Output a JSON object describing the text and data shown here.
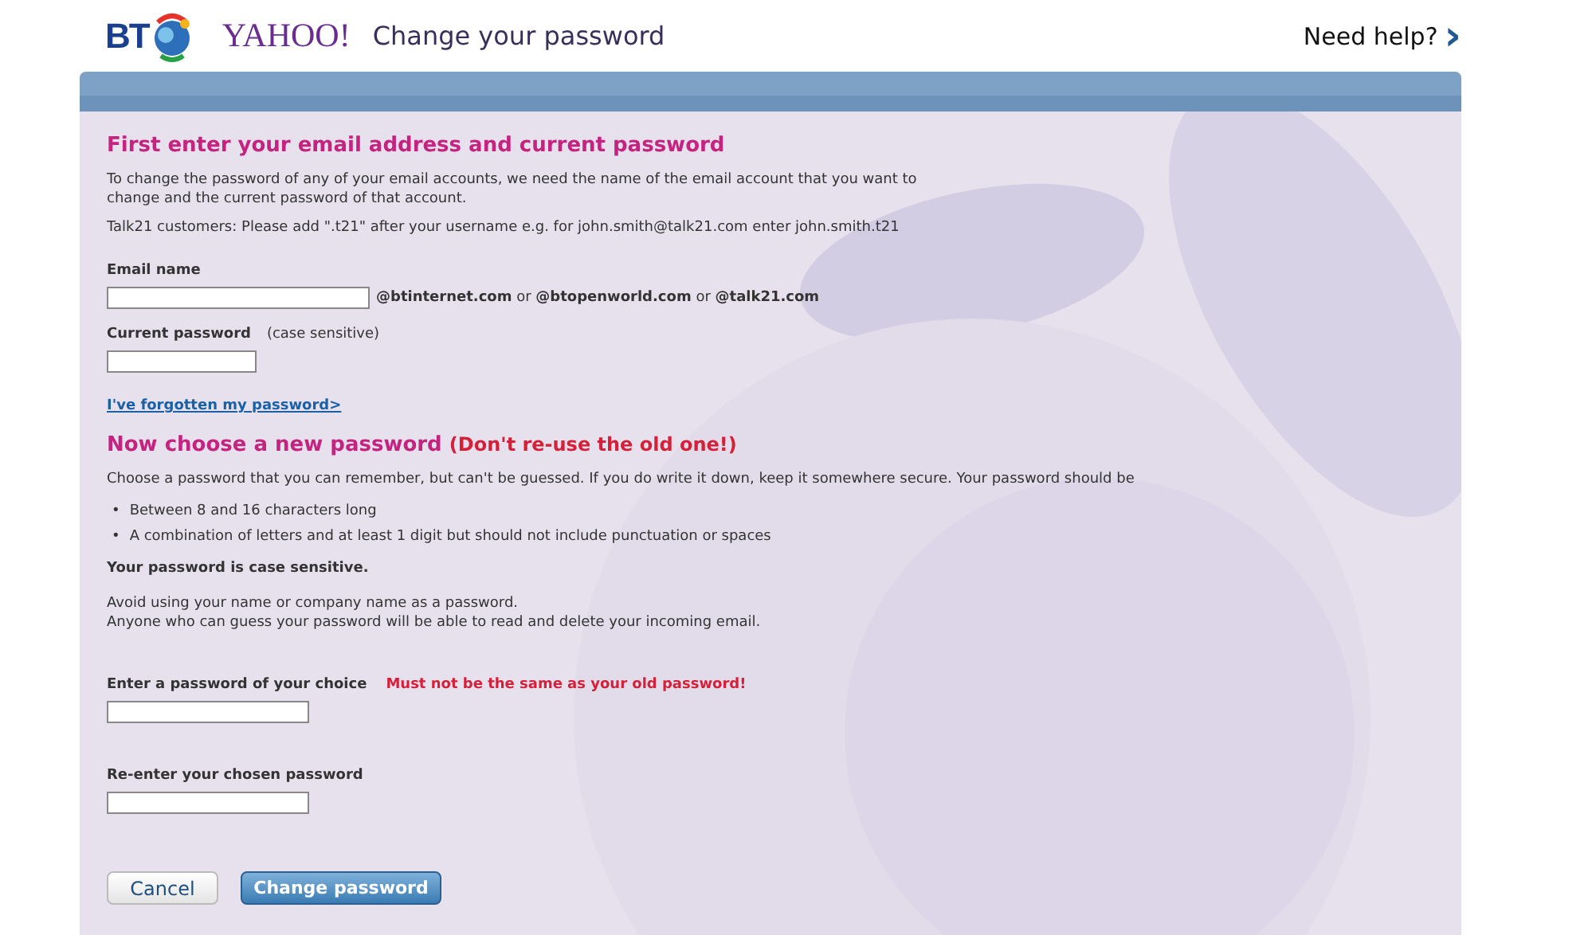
{
  "header": {
    "bt_logo": "BT",
    "yahoo_logo": "YAHOO!",
    "title": "Change your password",
    "help_link": "Need help?",
    "help_arrow": "›"
  },
  "section_1": {
    "heading": "First enter your email address and current password",
    "intro": "To change the password of any of your email accounts, we need the name of the email account that you want to change and the current password of that account.",
    "talk21_note": "Talk21 customers: Please add \".t21\" after your username e.g. for john.smith@talk21.com enter john.smith.t21",
    "email_label": "Email name",
    "email_domains": "**@btinternet.com** or **@btopenworld.com** or **@talk21.com**",
    "password_label": "Current password",
    "password_hint": "(case sensitive)",
    "forgot_link": "I've forgotten my password>"
  },
  "section_2": {
    "heading": "Now choose a new password",
    "heading_warning": "(Don't re-use the old one!)",
    "intro": "Choose a password that you can remember, but can't be guessed. If you do write it down, keep it somewhere secure. Your password should be",
    "bullet": "•",
    "rules": [
      "Between 8 and 16 characters long",
      "A combination of letters and at least 1 digit but should not include punctuation or spaces"
    ],
    "case_note": "Your password is case sensitive.",
    "advice": [
      "Avoid using your name or company name as a password.",
      "Anyone who can guess your password will be able to read and delete your incoming email."
    ],
    "new_label": "Enter a password of your choice",
    "new_warning": "Must not be the same as your old password!",
    "confirm_label": "Re-enter your chosen password"
  },
  "buttons": {
    "cancel": "Cancel",
    "submit": "Change password"
  }
}
